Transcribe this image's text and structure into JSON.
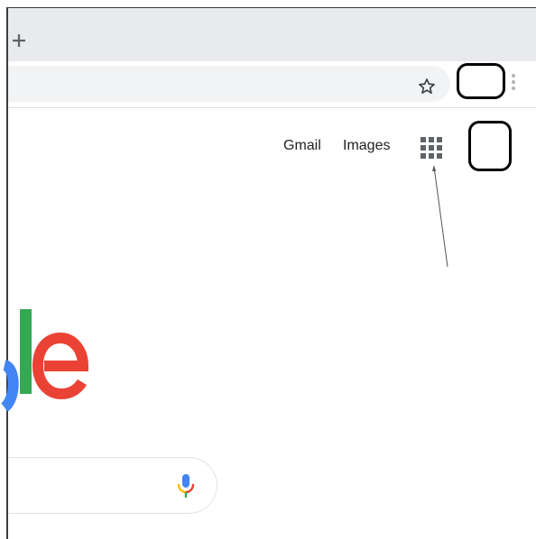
{
  "browser": {
    "new_tab_icon": "plus-icon",
    "bookmark_icon": "star-outline-icon",
    "menu_icon": "vertical-dots-icon"
  },
  "header": {
    "gmail_label": "Gmail",
    "images_label": "Images",
    "apps_icon": "apps-grid-icon",
    "text_color": "#202124"
  },
  "logo": {
    "brand_colors": {
      "blue": "#4285f4",
      "green": "#34a853",
      "red": "#ea4335"
    }
  },
  "search": {
    "mic_icon": "microphone-icon"
  },
  "colors": {
    "tabstrip": "#e8eaed",
    "omnibox": "#f1f3f4",
    "divider": "#dadce0",
    "icon_gray": "#5f6368"
  }
}
